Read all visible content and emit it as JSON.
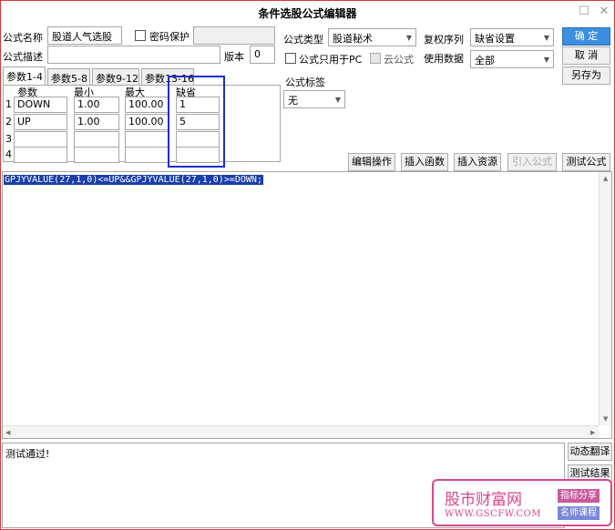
{
  "window": {
    "title": "条件选股公式编辑器"
  },
  "form": {
    "name_label": "公式名称",
    "name_value": "股道人气选股",
    "password_label": "密码保护",
    "desc_label": "公式描述",
    "desc_value": "",
    "version_label": "版本",
    "version_value": "0",
    "type_label": "公式类型",
    "type_value": "股道秘术",
    "fuquan_label": "复权序列",
    "fuquan_value": "缺省设置",
    "pc_only_label": "公式只用于PC",
    "cloud_label": "云公式",
    "data_label": "使用数据",
    "data_value": "全部",
    "tag_label": "公式标签",
    "tag_value": "无"
  },
  "buttons": {
    "ok": "确 定",
    "cancel": "取 消",
    "save_as": "另存为",
    "edit_ops": "编辑操作",
    "insert_func": "插入函数",
    "insert_res": "插入资源",
    "import": "引入公式",
    "test": "测试公式",
    "dyn_translate": "动态翻译",
    "test_result": "测试结果"
  },
  "tabs": [
    "参数1-4",
    "参数5-8",
    "参数9-12",
    "参数13-16"
  ],
  "params": {
    "headers": [
      "参数",
      "最小",
      "最大",
      "缺省"
    ],
    "rows": [
      {
        "num": "1",
        "name": "DOWN",
        "min": "1.00",
        "max": "100.00",
        "def": "1"
      },
      {
        "num": "2",
        "name": "UP",
        "min": "1.00",
        "max": "100.00",
        "def": "5"
      },
      {
        "num": "3",
        "name": "",
        "min": "",
        "max": "",
        "def": ""
      },
      {
        "num": "4",
        "name": "",
        "min": "",
        "max": "",
        "def": ""
      }
    ]
  },
  "editor": {
    "code": "GPJYVALUE(27,1,0)<=UP&&GPJYVALUE(27,1,0)>=DOWN;"
  },
  "output": {
    "text": "测试通过!"
  },
  "watermark": {
    "title": "股市财富网",
    "url": "WWW.GSCFW.COM",
    "tag1": "指标分享",
    "tag2": "名师课程"
  },
  "colors": {
    "highlight_box": "#1f2fd0",
    "frame": "#d23a3a",
    "watermark": "#d9468c",
    "code_bg": "#1b3fa8",
    "ok_button": "#3c8fe0"
  }
}
